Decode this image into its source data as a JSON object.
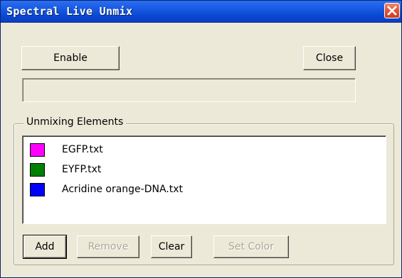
{
  "window": {
    "title": "Spectral Live Unmix",
    "close_icon": "close-icon"
  },
  "buttons": {
    "enable": "Enable",
    "close": "Close",
    "add": "Add",
    "remove": "Remove",
    "clear": "Clear",
    "set_color": "Set Color"
  },
  "status_field": {
    "value": ""
  },
  "unmixing": {
    "group_label": "Unmixing Elements",
    "items": [
      {
        "label": "EGFP.txt",
        "color": "#ff00ff"
      },
      {
        "label": "EYFP.txt",
        "color": "#008000"
      },
      {
        "label": "Acridine orange-DNA.txt",
        "color": "#0000ff"
      }
    ]
  },
  "colors": {
    "titlebar": "#0a48d2",
    "window_bg": "#ece9d8",
    "close_button": "#e2573a"
  }
}
